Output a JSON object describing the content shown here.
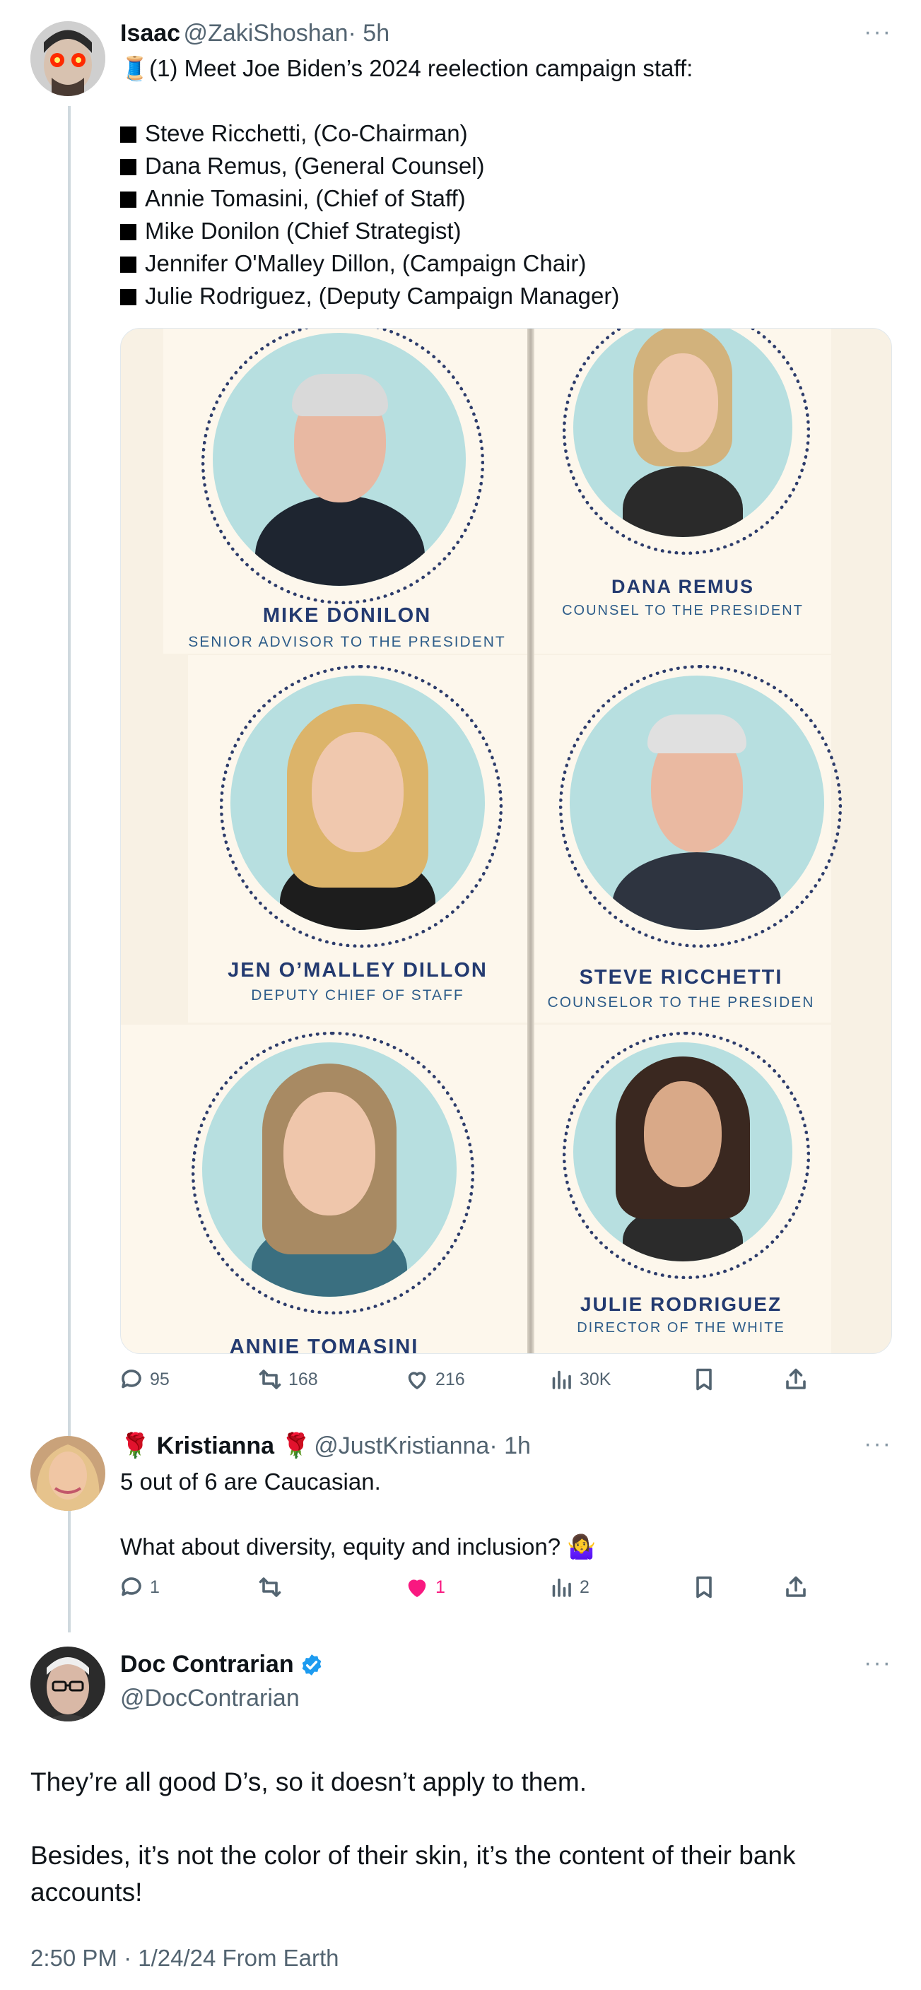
{
  "tweet1": {
    "name": "Isaac",
    "handle": "@ZakiShoshan",
    "time": "· 5h",
    "more": "···",
    "intro": "🧵(1) Meet Joe Biden’s 2024 reelection campaign staff:",
    "bullets": [
      "Steve Ricchetti, (Co-Chairman)",
      "Dana Remus, (General Counsel)",
      "Annie Tomasini, (Chief of Staff)",
      "Mike Donilon (Chief Strategist)",
      "Jennifer O'Malley Dillon, (Campaign Chair)",
      "Julie Rodriguez, (Deputy Campaign Manager)"
    ],
    "image_captions": [
      {
        "name": "MIKE DONILON",
        "role": "SENIOR ADVISOR TO THE PRESIDENT"
      },
      {
        "name": "DANA REMUS",
        "role": "COUNSEL TO THE PRESIDENT"
      },
      {
        "name": "JEN O’MALLEY DILLON",
        "role": "DEPUTY CHIEF OF STAFF"
      },
      {
        "name": "STEVE RICCHETTI",
        "role": "COUNSELOR TO THE PRESIDEN"
      },
      {
        "name": "ANNIE TOMASINI",
        "role": ""
      },
      {
        "name": "JULIE RODRIGUEZ",
        "role": "DIRECTOR OF THE WHITE"
      }
    ],
    "stats": {
      "replies": "95",
      "reposts": "168",
      "likes": "216",
      "views": "30K"
    }
  },
  "tweet2": {
    "name": "🌹 Kristianna 🌹",
    "handle": "@JustKristianna",
    "time": "· 1h",
    "more": "···",
    "line1": "5 out of 6 are Caucasian.",
    "line2": "What about  diversity, equity and inclusion? 🤷‍♀️",
    "stats": {
      "replies": "1",
      "reposts": "",
      "likes": "1",
      "views": "2"
    }
  },
  "tweet3": {
    "name": "Doc Contrarian",
    "handle": "@DocContrarian",
    "more": "···",
    "para1": "They’re all good D’s, so it doesn’t apply to them.",
    "para2": "Besides, it’s not the color of their skin, it’s the content of their bank accounts!",
    "meta": "2:50 PM · 1/24/24 From Earth"
  },
  "colors": {
    "like_active": "#f91880",
    "verified": "#1d9bf0",
    "caption_navy": "#233a70"
  }
}
